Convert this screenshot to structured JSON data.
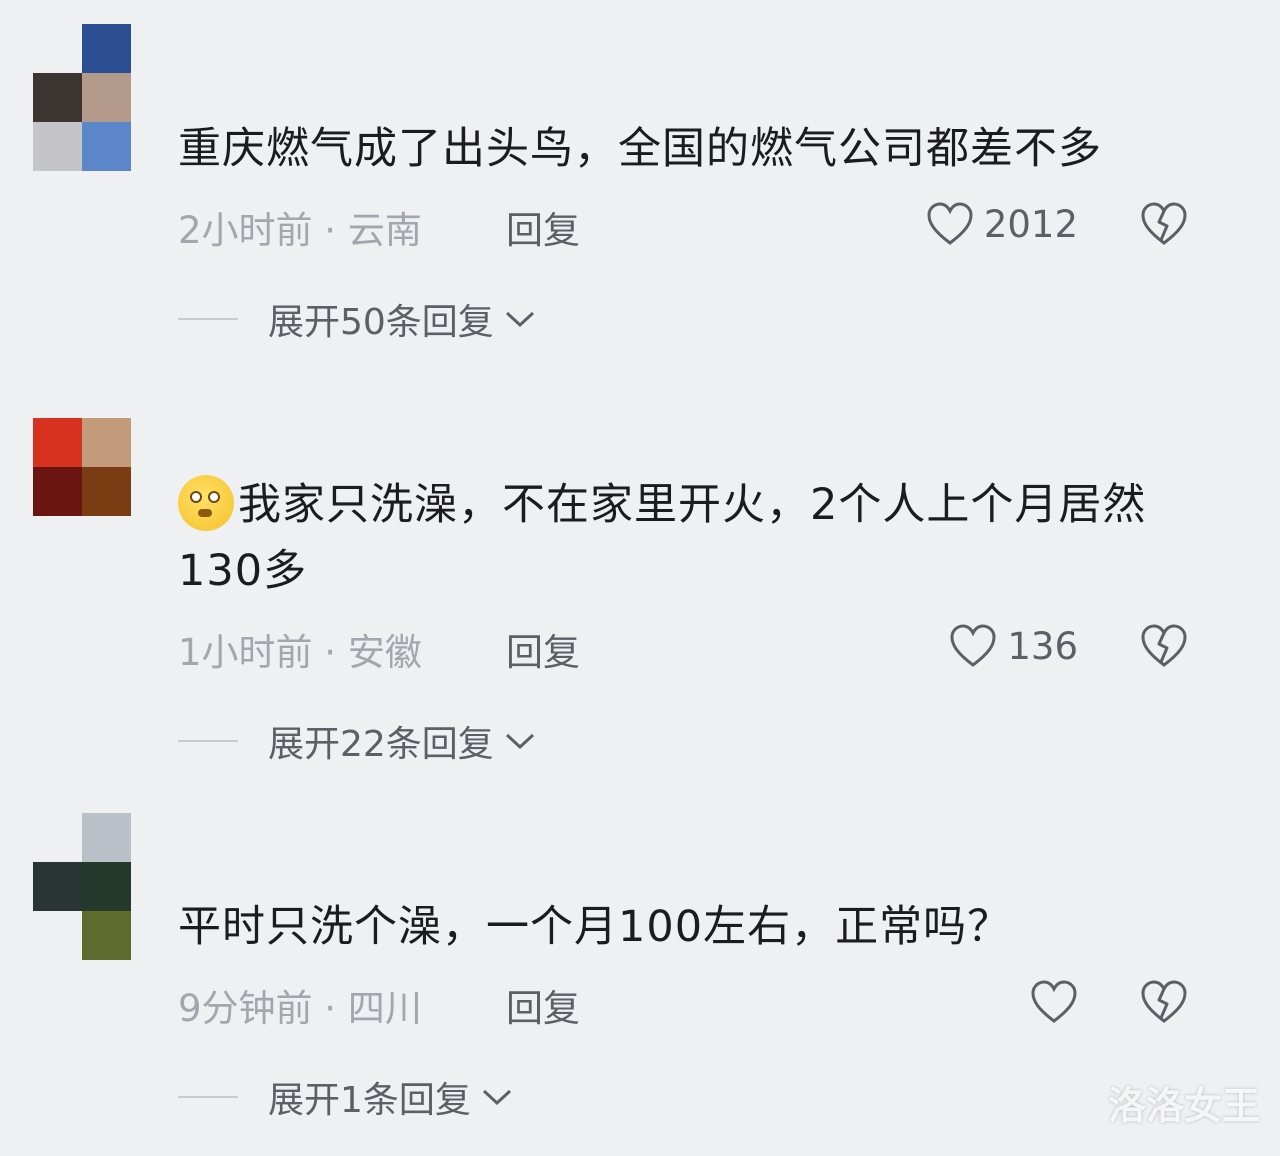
{
  "comments": [
    {
      "text": "重庆燃气成了出头鸟，全国的燃气公司都差不多",
      "time_location": "2小时前 · 云南",
      "reply_label": "回复",
      "like_count": "2012",
      "expand_label": "展开50条回复"
    },
    {
      "text": "我家只洗澡，不在家里开火，2个人上个月居然130多",
      "time_location": "1小时前 · 安徽",
      "reply_label": "回复",
      "like_count": "136",
      "expand_label": "展开22条回复",
      "emoji": "pleading-face-emoji"
    },
    {
      "text": "平时只洗个澡，一个月100左右，正常吗？",
      "time_location": "9分钟前 · 四川",
      "reply_label": "回复",
      "like_count": "",
      "expand_label": "展开1条回复"
    }
  ],
  "icons": {
    "like": "heart-outline-icon",
    "dislike": "broken-heart-icon",
    "expand": "chevron-down-icon"
  },
  "colors": {
    "background": "#eff0f2",
    "text_primary": "#1c1c1e",
    "text_secondary": "#a3a6ac",
    "text_action": "#5c5f65"
  },
  "watermark": "洛洛女王"
}
